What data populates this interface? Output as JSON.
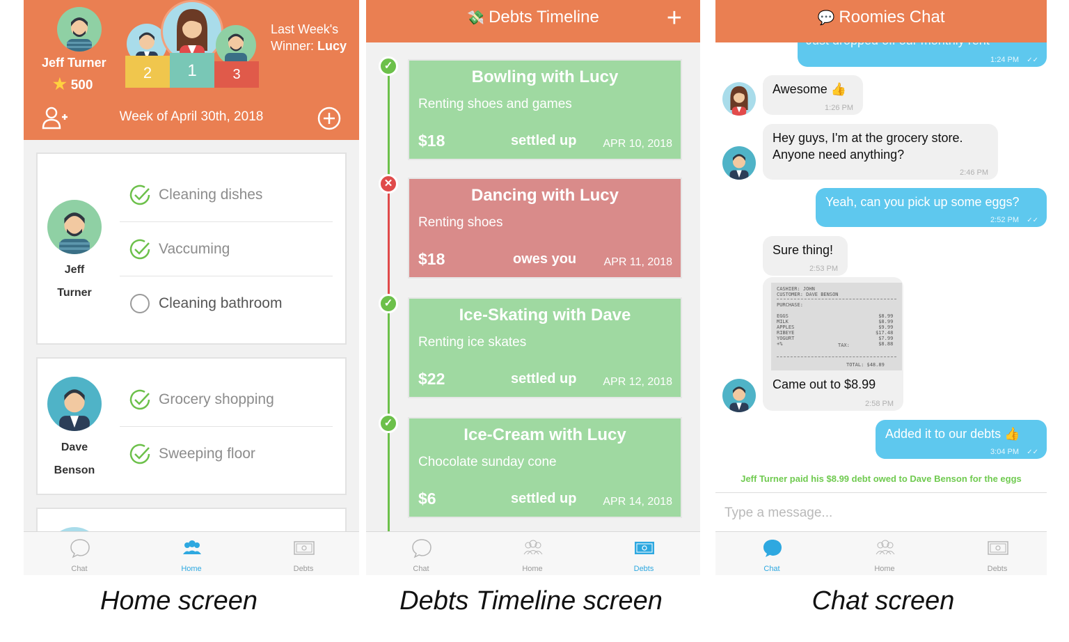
{
  "home": {
    "user_name": "Jeff Turner",
    "score": "500",
    "winner_label": "Last Week's",
    "winner_prefix": "Winner:",
    "winner_name": "Lucy",
    "week": "Week of April 30th, 2018",
    "podium": [
      "2",
      "1",
      "3"
    ],
    "members": [
      {
        "first": "Jeff",
        "last": "Turner",
        "tasks": [
          {
            "label": "Cleaning dishes",
            "done": true
          },
          {
            "label": "Vaccuming",
            "done": true
          },
          {
            "label": "Cleaning bathroom",
            "done": false
          }
        ]
      },
      {
        "first": "Dave",
        "last": "Benson",
        "tasks": [
          {
            "label": "Grocery shopping",
            "done": true
          },
          {
            "label": "Sweeping floor",
            "done": true
          }
        ]
      }
    ],
    "caption": "Home screen"
  },
  "tabs": {
    "chat": "Chat",
    "home": "Home",
    "debts": "Debts"
  },
  "debts": {
    "title": "Debts Timeline",
    "items": [
      {
        "title": "Bowling with Lucy",
        "desc": "Renting shoes and games",
        "amount": "$18",
        "status": "settled up",
        "date": "APR 10, 2018",
        "color": "#9fd9a1"
      },
      {
        "title": "Dancing with Lucy",
        "desc": "Renting shoes",
        "amount": "$18",
        "status": "owes you",
        "date": "APR 11, 2018",
        "color": "#d98b8a"
      },
      {
        "title": "Ice-Skating with Dave",
        "desc": "Renting ice skates",
        "amount": "$22",
        "status": "settled up",
        "date": "APR 12, 2018",
        "color": "#9fd9a1"
      },
      {
        "title": "Ice-Cream with Lucy",
        "desc": "Chocolate sunday cone",
        "amount": "$6",
        "status": "settled up",
        "date": "APR 14, 2018",
        "color": "#9fd9a1"
      }
    ],
    "caption": "Debts Timeline screen"
  },
  "chat": {
    "title": "Roomies Chat",
    "messages": [
      {
        "text": "Just dropped off our monthly rent",
        "time": "1:24 PM",
        "dir": "out"
      },
      {
        "text": "Awesome 👍",
        "time": "1:26 PM",
        "dir": "in"
      },
      {
        "text": "Hey guys, I'm at the grocery store.\nAnyone need anything?",
        "time": "2:46 PM",
        "dir": "in"
      },
      {
        "text": "Yeah, can you pick up some eggs?",
        "time": "2:52 PM",
        "dir": "out"
      },
      {
        "text": "Sure thing!",
        "time": "2:53 PM",
        "dir": "in"
      },
      {
        "text": "Came out to $8.99",
        "time": "2:58 PM",
        "dir": "in"
      },
      {
        "text": "Added it to our debts 👍",
        "time": "3:04 PM",
        "dir": "out"
      }
    ],
    "receipt": {
      "head": "CASHIER: JOHN\nCUSTOMER: DAVE BENSON",
      "purchase": "PURCHASE:",
      "items": "EGGS\nMILK\nAPPLES\nRIBEYE\nYOGURT\n+%",
      "prices": "$8.99\n$8.99\n$9.99\n$17.48\n$7.99\n$8.88",
      "tax": "TAX:",
      "total": "TOTAL: $48.89"
    },
    "note": "Jeff Turner paid his $8.99 debt owed to Dave Benson for the eggs",
    "placeholder": "Type a message...",
    "caption": "Chat screen"
  }
}
